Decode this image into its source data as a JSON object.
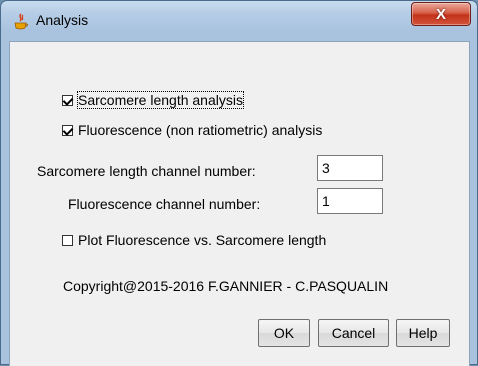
{
  "window": {
    "title": "Analysis",
    "close_glyph": "X",
    "icon": "java-cup-icon"
  },
  "options": {
    "sarcomere_analysis": {
      "label": "Sarcomere length analysis",
      "checked": true
    },
    "fluorescence_analysis": {
      "label": "Fluorescence (non ratiometric) analysis",
      "checked": true
    },
    "plot_fluorescence": {
      "label": "Plot Fluorescence vs. Sarcomere length",
      "checked": false
    }
  },
  "fields": {
    "sarcomere_channel": {
      "label": "Sarcomere length channel number:",
      "value": "3"
    },
    "fluorescence_channel": {
      "label": "Fluorescence channel number:",
      "value": "1"
    }
  },
  "copyright": "Copyright@2015-2016 F.GANNIER - C.PASQUALIN",
  "buttons": {
    "ok": "OK",
    "cancel": "Cancel",
    "help": "Help"
  }
}
